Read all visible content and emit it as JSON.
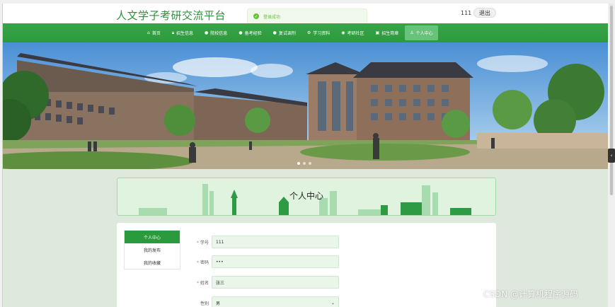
{
  "header": {
    "site_title": "人文学子考研交流平台",
    "user_name": "111",
    "logout_label": "退出"
  },
  "toast": {
    "message": "登录成功",
    "icon": "check-circle-icon",
    "color": "#67c23a"
  },
  "nav": {
    "items": [
      {
        "label": "首页",
        "icon": "home-icon"
      },
      {
        "label": "招生信息",
        "icon": "lock-icon"
      },
      {
        "label": "院校信息",
        "icon": "circle-icon"
      },
      {
        "label": "备考经验",
        "icon": "circle-icon"
      },
      {
        "label": "复试调剂",
        "icon": "circle-icon"
      },
      {
        "label": "学习资料",
        "icon": "gear-icon"
      },
      {
        "label": "考研社区",
        "icon": "chat-icon"
      },
      {
        "label": "招生简章",
        "icon": "camera-icon"
      },
      {
        "label": "个人中心",
        "icon": "user-icon"
      }
    ],
    "active_index": 8,
    "color": "#2b9a3c"
  },
  "banner": {
    "slides": 3,
    "active_slide": 0
  },
  "page": {
    "title": "个人中心"
  },
  "side_menu": {
    "items": [
      {
        "label": "个人中心"
      },
      {
        "label": "我的发布"
      },
      {
        "label": "我的收藏"
      }
    ],
    "active_index": 0
  },
  "form": {
    "fields": [
      {
        "label": "学号",
        "required": true,
        "value": "111"
      },
      {
        "label": "密码",
        "required": true,
        "value": "•••"
      },
      {
        "label": "姓名",
        "required": true,
        "value": "张三"
      },
      {
        "label": "性别",
        "required": false,
        "value": "男"
      }
    ]
  },
  "watermark": "CSDN @计算机程序源码"
}
